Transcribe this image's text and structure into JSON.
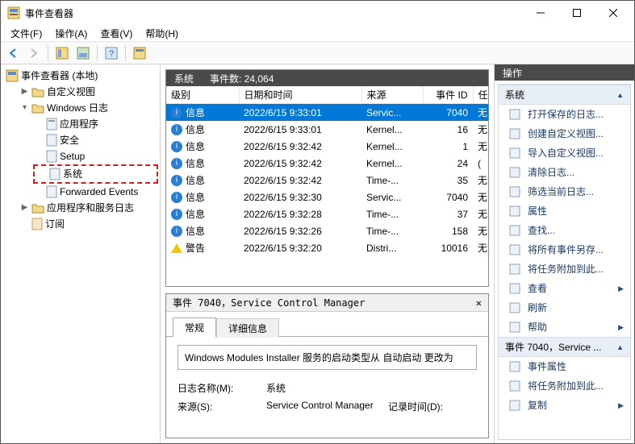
{
  "window": {
    "title": "事件查看器"
  },
  "menu": {
    "file": "文件(F)",
    "action": "操作(A)",
    "view": "查看(V)",
    "help": "帮助(H)"
  },
  "tree": {
    "root": "事件查看器 (本地)",
    "custom_views": "自定义视图",
    "windows_logs": "Windows 日志",
    "logs": {
      "app": "应用程序",
      "security": "安全",
      "setup": "Setup",
      "system": "系统",
      "forwarded": "Forwarded Events"
    },
    "app_service_logs": "应用程序和服务日志",
    "subscriptions": "订阅"
  },
  "list": {
    "header_label": "系统",
    "count_label": "事件数: 24,064",
    "cols": {
      "level": "级别",
      "datetime": "日期和时间",
      "source": "来源",
      "eventid": "事件 ID",
      "task": "任"
    },
    "rows": [
      {
        "level": "信息",
        "dt": "2022/6/15 9:33:01",
        "src": "Servic...",
        "id": "7040",
        "task": "无",
        "selected": true
      },
      {
        "level": "信息",
        "dt": "2022/6/15 9:33:01",
        "src": "Kernel...",
        "id": "16",
        "task": "无"
      },
      {
        "level": "信息",
        "dt": "2022/6/15 9:32:42",
        "src": "Kernel...",
        "id": "1",
        "task": "无"
      },
      {
        "level": "信息",
        "dt": "2022/6/15 9:32:42",
        "src": "Kernel...",
        "id": "24",
        "task": "("
      },
      {
        "level": "信息",
        "dt": "2022/6/15 9:32:42",
        "src": "Time-...",
        "id": "35",
        "task": "无"
      },
      {
        "level": "信息",
        "dt": "2022/6/15 9:32:30",
        "src": "Servic...",
        "id": "7040",
        "task": "无"
      },
      {
        "level": "信息",
        "dt": "2022/6/15 9:32:28",
        "src": "Time-...",
        "id": "37",
        "task": "无"
      },
      {
        "level": "信息",
        "dt": "2022/6/15 9:32:26",
        "src": "Time-...",
        "id": "158",
        "task": "无"
      },
      {
        "level": "警告",
        "dt": "2022/6/15 9:32:20",
        "src": "Distri...",
        "id": "10016",
        "task": "无",
        "warn": true
      }
    ]
  },
  "detail": {
    "title": "事件 7040，Service Control Manager",
    "tabs": {
      "general": "常规",
      "details": "详细信息"
    },
    "message": "Windows Modules Installer 服务的启动类型从 自动启动 更改为",
    "fields": {
      "log_name_label": "日志名称(M):",
      "log_name": "系统",
      "source_label": "来源(S):",
      "source": "Service Control Manager",
      "logged_label": "记录时间(D):"
    }
  },
  "actions": {
    "title": "操作",
    "section1": "系统",
    "items1": [
      "打开保存的日志...",
      "创建自定义视图...",
      "导入自定义视图...",
      "清除日志...",
      "筛选当前日志...",
      "属性",
      "查找...",
      "将所有事件另存...",
      "将任务附加到此...",
      "查看",
      "刷新",
      "帮助"
    ],
    "section2": "事件 7040，Service ...",
    "items2": [
      "事件属性",
      "将任务附加到此...",
      "复制"
    ],
    "arrows": {
      "view": true,
      "help": true,
      "copy": true
    }
  },
  "colors": {
    "accent": "#0078d7"
  }
}
